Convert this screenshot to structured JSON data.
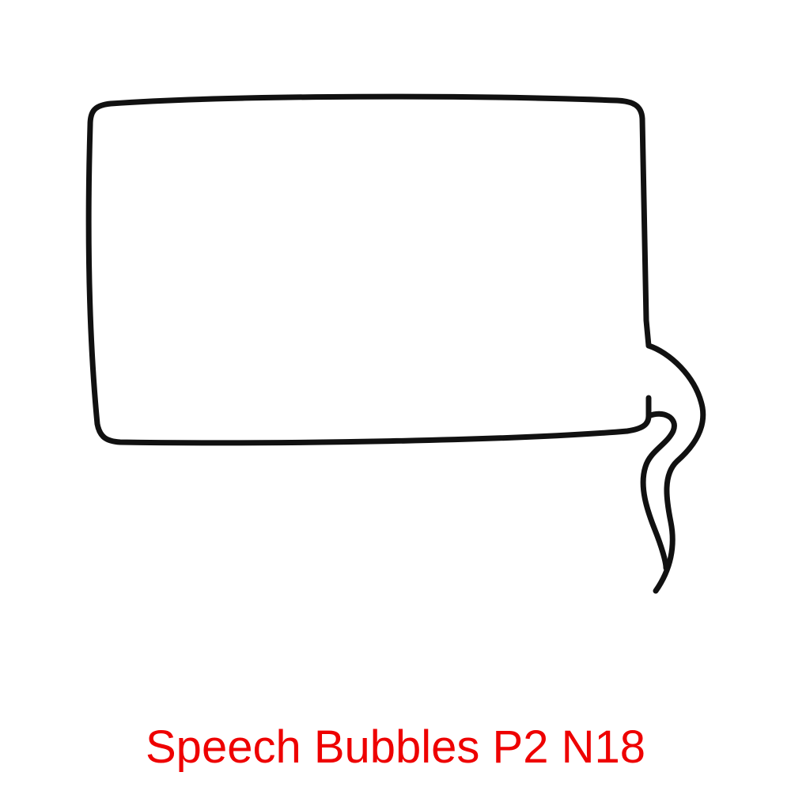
{
  "caption": {
    "text": "Speech Bubbles P2 N18",
    "color": "#ee0000"
  },
  "bubble": {
    "shape": "rectangular speech bubble with wavy tail at lower right",
    "stroke_color": "#111111",
    "fill_color": "#ffffff"
  }
}
